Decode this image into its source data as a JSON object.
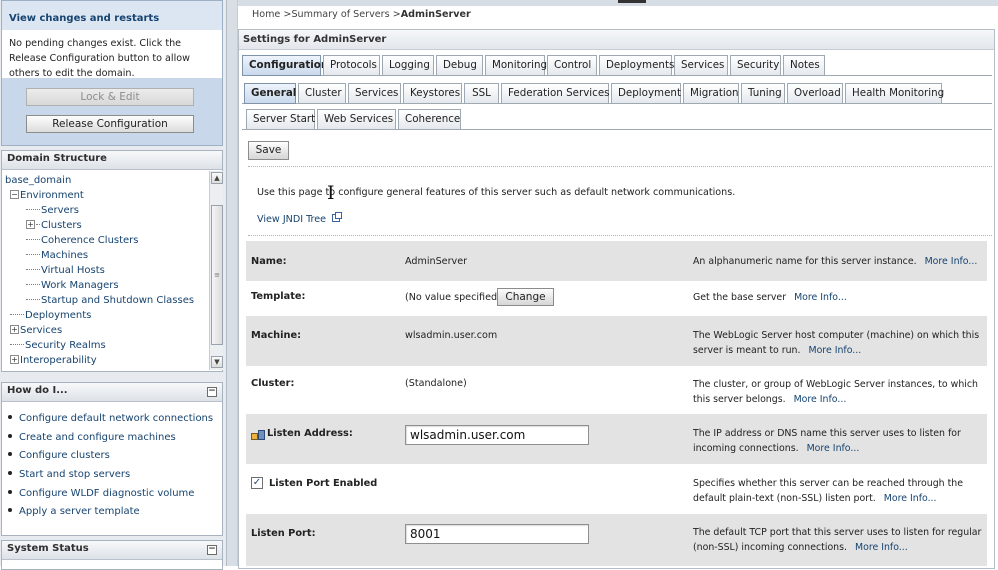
{
  "change_center": {
    "title": "View changes and restarts",
    "message": "No pending changes exist. Click the Release Configuration button to allow others to edit the domain.",
    "lock_edit_label": "Lock & Edit",
    "release_label": "Release Configuration"
  },
  "domain_structure": {
    "title": "Domain Structure",
    "collapse_symbol": "−",
    "items": [
      {
        "label": "base_domain"
      },
      {
        "label": "Environment",
        "toggle": "−"
      },
      {
        "label": "Servers"
      },
      {
        "label": "Clusters",
        "toggle": "+"
      },
      {
        "label": "Coherence Clusters"
      },
      {
        "label": "Machines"
      },
      {
        "label": "Virtual Hosts"
      },
      {
        "label": "Work Managers"
      },
      {
        "label": "Startup and Shutdown Classes"
      },
      {
        "label": "Deployments"
      },
      {
        "label": "Services",
        "toggle": "+"
      },
      {
        "label": "Security Realms"
      },
      {
        "label": "Interoperability",
        "toggle": "+"
      }
    ]
  },
  "how_do_i": {
    "title": "How do I...",
    "collapse_symbol": "−",
    "items": [
      "Configure default network connections",
      "Create and configure machines",
      "Configure clusters",
      "Start and stop servers",
      "Configure WLDF diagnostic volume",
      "Apply a server template"
    ]
  },
  "system_status": {
    "title": "System Status",
    "collapse_symbol": "−"
  },
  "breadcrumb": {
    "home": "Home",
    "sep": " >",
    "summary": "Summary of Servers",
    "current": "AdminServer"
  },
  "settings": {
    "title": "Settings for AdminServer",
    "main_tabs": [
      "Configuration",
      "Protocols",
      "Logging",
      "Debug",
      "Monitoring",
      "Control",
      "Deployments",
      "Services",
      "Security",
      "Notes"
    ],
    "active_main_tab": "Configuration",
    "sub_tabs": [
      "General",
      "Cluster",
      "Services",
      "Keystores",
      "SSL",
      "Federation Services",
      "Deployment",
      "Migration",
      "Tuning",
      "Overload",
      "Health Monitoring"
    ],
    "sub_tabs_row2": [
      "Server Start",
      "Web Services",
      "Coherence"
    ],
    "active_sub_tab": "General",
    "save_label": "Save",
    "intro": "Use this page to configure general features of this server such as default network communications.",
    "jndi_link": "View JNDI Tree",
    "more_info": "More Info...",
    "fields": {
      "name": {
        "label": "Name:",
        "value": "AdminServer",
        "desc": "An alphanumeric name for this server instance."
      },
      "template": {
        "label": "Template:",
        "value": "(No value specified)",
        "button": "Change",
        "desc": "Get the base server"
      },
      "machine": {
        "label": "Machine:",
        "value": "wlsadmin.user.com",
        "desc": "The WebLogic Server host computer (machine) on which this server is meant to run."
      },
      "cluster": {
        "label": "Cluster:",
        "value": "(Standalone)",
        "desc": "The cluster, or group of WebLogic Server instances, to which this server belongs."
      },
      "listen_address": {
        "label": "Listen Address:",
        "value": "wlsadmin.user.com",
        "desc": "The IP address or DNS name this server uses to listen for incoming connections."
      },
      "listen_port_enabled": {
        "label": "Listen Port Enabled",
        "checked": true,
        "check_mark": "✓",
        "desc": "Specifies whether this server can be reached through the default plain-text (non-SSL) listen port."
      },
      "listen_port": {
        "label": "Listen Port:",
        "value": "8001",
        "desc": "The default TCP port that this server uses to listen for regular (non-SSL) incoming connections."
      }
    }
  },
  "colors": {
    "link": "#16436f",
    "shade_row": "#e3e3e3",
    "active_tab": "#c9d9ec",
    "change_center_bg": "#c9d7ea"
  },
  "icons": {
    "lock-edit": "lock-icon",
    "external-link": "external-link-icon",
    "listen-address": "network-icon"
  }
}
